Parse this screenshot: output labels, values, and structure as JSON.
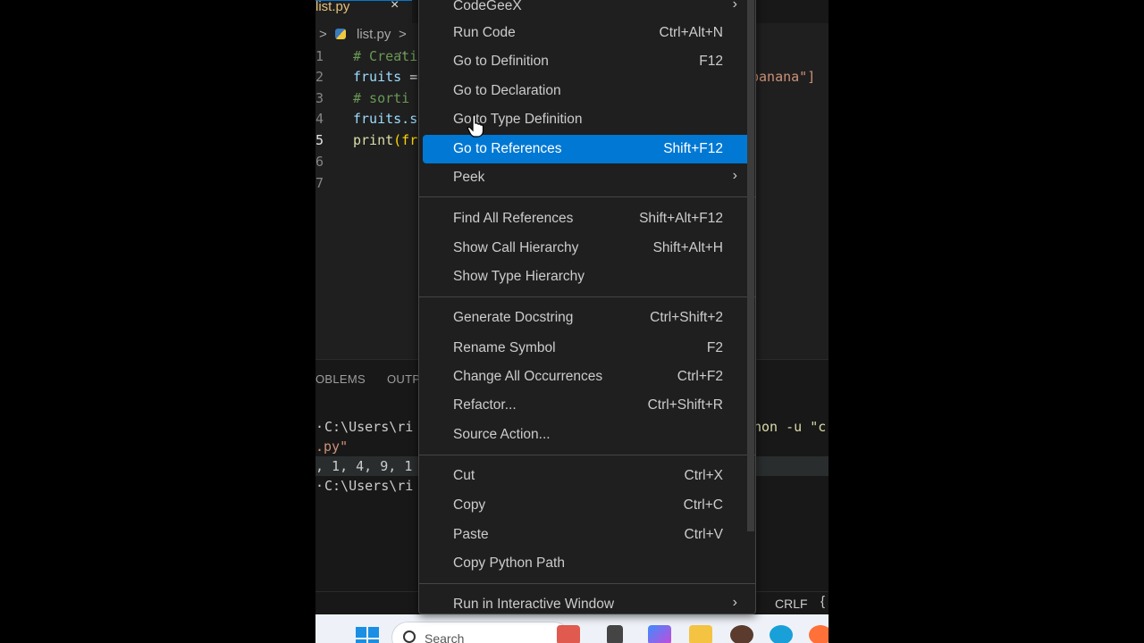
{
  "editor_tab": {
    "file_label": "list.py",
    "close_glyph": "×"
  },
  "breadcrumb": {
    "chevron": ">",
    "file": "list.py",
    "separator": "> .."
  },
  "code_lines": [
    {
      "num": "1",
      "text": "# Creati"
    },
    {
      "num": "2",
      "var": "fruits",
      "rest": " =",
      "tail": "banana\"]"
    },
    {
      "num": "3",
      "text": "# sorti"
    },
    {
      "num": "4",
      "var": "fruits.s"
    },
    {
      "num": "5",
      "fn": "print",
      "rest": "(fr"
    },
    {
      "num": "6"
    },
    {
      "num": "7"
    }
  ],
  "panel": {
    "tabs": [
      "OBLEMS",
      "OUTP"
    ],
    "terminal": [
      {
        "text": "C:\\Users\\ri",
        "tail": "hon -u \"c"
      },
      {
        "text": ".py\""
      },
      {
        "text": ", 1, 4, 9, 1"
      },
      {
        "text": "C:\\Users\\ri"
      }
    ]
  },
  "status_bar": {
    "eol": "CRLF",
    "lang_indicator": "{"
  },
  "taskbar": {
    "search_placeholder": "Search"
  },
  "context_menu": {
    "items": [
      {
        "label": "CodeGeeX",
        "submenu": true
      },
      {
        "label": "Run Code",
        "shortcut": "Ctrl+Alt+N"
      },
      {
        "label": "Go to Definition",
        "shortcut": "F12"
      },
      {
        "label": "Go to Declaration",
        "shortcut": ""
      },
      {
        "label": "Go to Type Definition",
        "shortcut": ""
      },
      {
        "label": "Go to References",
        "shortcut": "Shift+F12",
        "highlighted": true
      },
      {
        "label": "Peek",
        "submenu": true
      },
      {
        "label": "Find All References",
        "shortcut": "Shift+Alt+F12"
      },
      {
        "label": "Show Call Hierarchy",
        "shortcut": "Shift+Alt+H"
      },
      {
        "label": "Show Type Hierarchy",
        "shortcut": ""
      },
      {
        "label": "Generate Docstring",
        "shortcut": "Ctrl+Shift+2"
      },
      {
        "label": "Rename Symbol",
        "shortcut": "F2"
      },
      {
        "label": "Change All Occurrences",
        "shortcut": "Ctrl+F2"
      },
      {
        "label": "Refactor...",
        "shortcut": "Ctrl+Shift+R"
      },
      {
        "label": "Source Action...",
        "shortcut": ""
      },
      {
        "label": "Cut",
        "shortcut": "Ctrl+X"
      },
      {
        "label": "Copy",
        "shortcut": "Ctrl+C"
      },
      {
        "label": "Paste",
        "shortcut": "Ctrl+V"
      },
      {
        "label": "Copy Python Path",
        "shortcut": ""
      },
      {
        "label": "Run in Interactive Window",
        "submenu": true
      }
    ],
    "submenu_glyph": "›"
  },
  "colors": {
    "accent": "#0078d4",
    "menu_bg": "#1f1f1f",
    "editor_bg": "#1f1f1f"
  }
}
